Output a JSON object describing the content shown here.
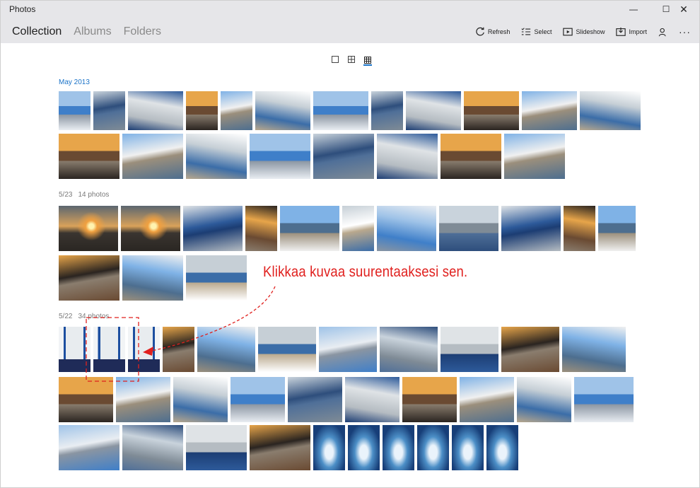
{
  "window": {
    "title": "Photos",
    "minimize": "—",
    "maximize": "☐",
    "close": "✕"
  },
  "nav": {
    "tabs": [
      "Collection",
      "Albums",
      "Folders"
    ],
    "active": "Collection"
  },
  "toolbar": {
    "refresh": "Refresh",
    "select": "Select",
    "slideshow": "Slideshow",
    "import": "Import",
    "account_icon": "person-icon",
    "more": "···"
  },
  "zoom_options": [
    "single-square-icon",
    "four-squares-icon",
    "nine-squares-icon"
  ],
  "groups": [
    {
      "id": "may",
      "title": "May 2013",
      "count": "",
      "style": "month"
    },
    {
      "id": "g1",
      "title": "5/23",
      "count": "14 photos",
      "style": "day"
    },
    {
      "id": "g2",
      "title": "5/22",
      "count": "34 photos",
      "style": "day"
    }
  ],
  "annotation": {
    "text": "Klikkaa kuvaa suurentaaksesi sen.",
    "color": "#e0201e"
  },
  "colors": {
    "accent": "#1a73c8",
    "chrome": "#e6e6e9"
  }
}
